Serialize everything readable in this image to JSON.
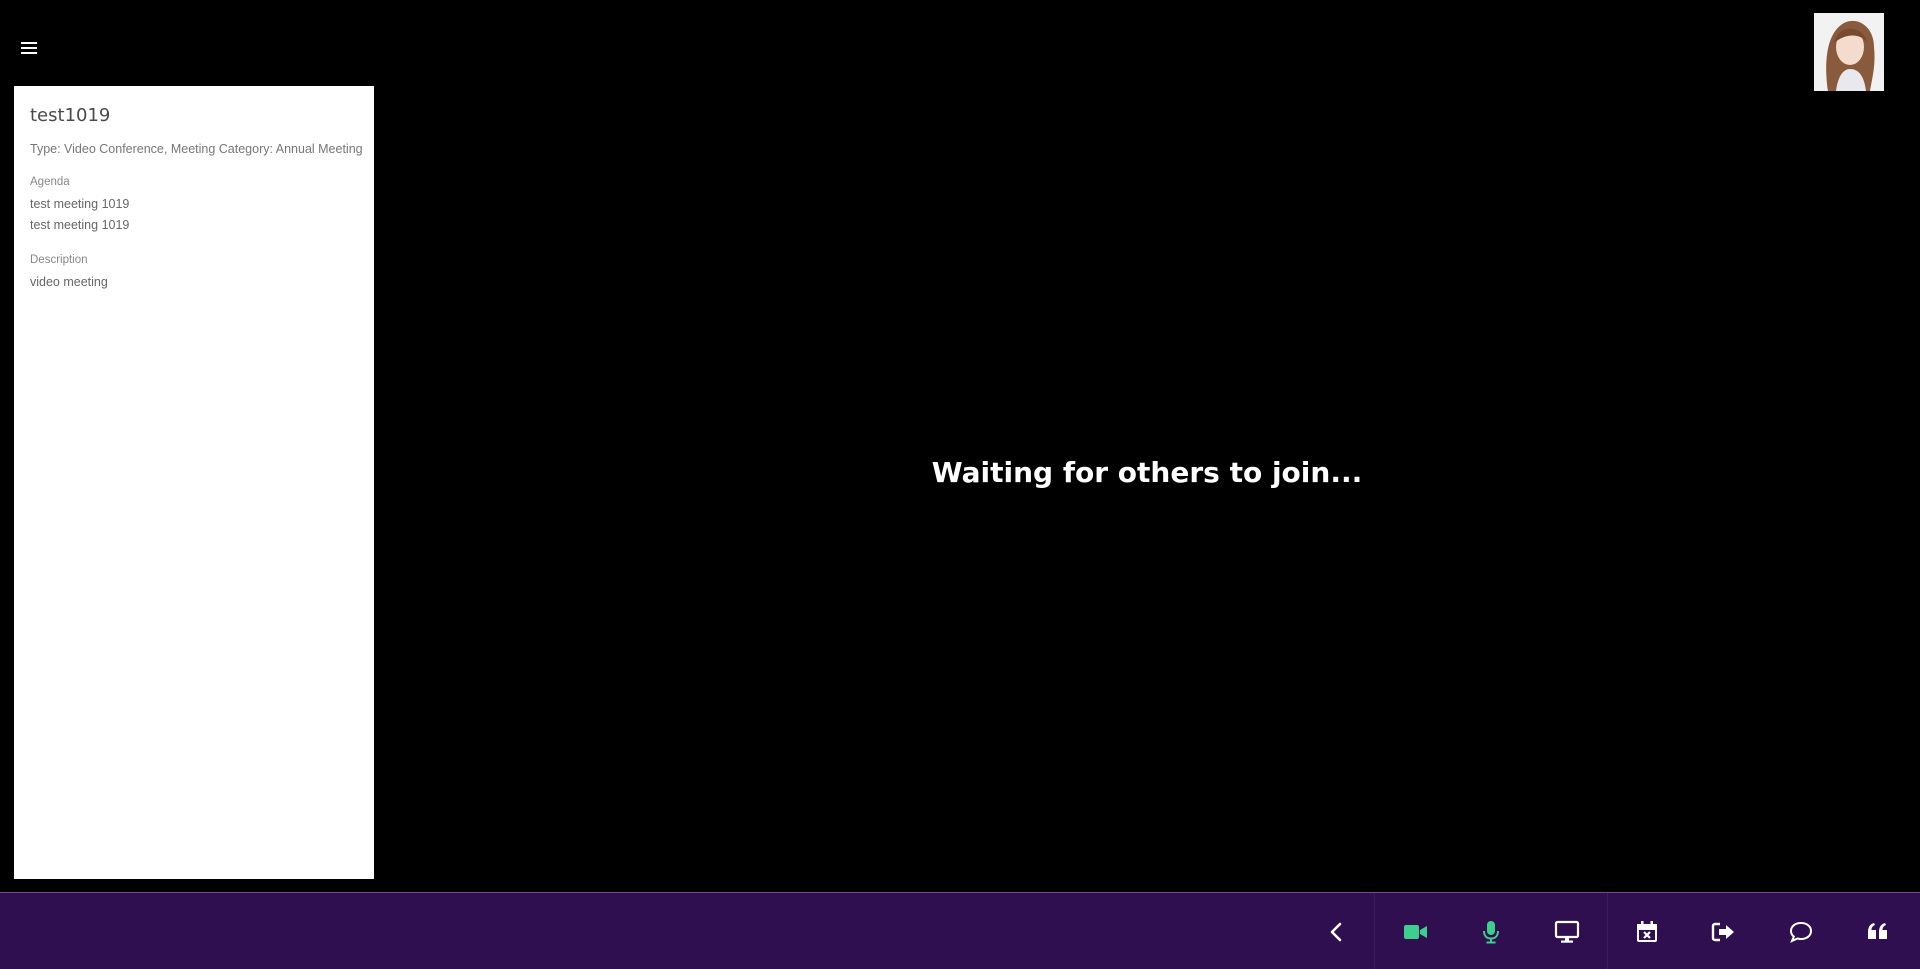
{
  "meeting": {
    "title": "test1019",
    "meta": "Type: Video Conference, Meeting Category: Annual Meeting",
    "agenda_label": "Agenda",
    "agenda_lines": [
      "test meeting 1019",
      "test meeting 1019"
    ],
    "description_label": "Description",
    "description": "video meeting"
  },
  "main": {
    "status": "Waiting for others to join..."
  },
  "toolbar": {
    "buttons": [
      {
        "name": "collapse-button",
        "icon": "chevron-left-icon"
      },
      {
        "name": "camera-button",
        "icon": "video-camera-icon"
      },
      {
        "name": "microphone-button",
        "icon": "microphone-icon"
      },
      {
        "name": "screen-share-button",
        "icon": "monitor-icon"
      },
      {
        "name": "end-meeting-button",
        "icon": "calendar-x-icon"
      },
      {
        "name": "leave-button",
        "icon": "sign-out-icon"
      },
      {
        "name": "chat-button",
        "icon": "chat-bubble-icon"
      },
      {
        "name": "notes-button",
        "icon": "quote-icon"
      }
    ]
  },
  "colors": {
    "toolbar_bg": "#2f0f4f",
    "active_icon": "#3ccf8e",
    "icon": "#ffffff",
    "background": "#000000"
  }
}
